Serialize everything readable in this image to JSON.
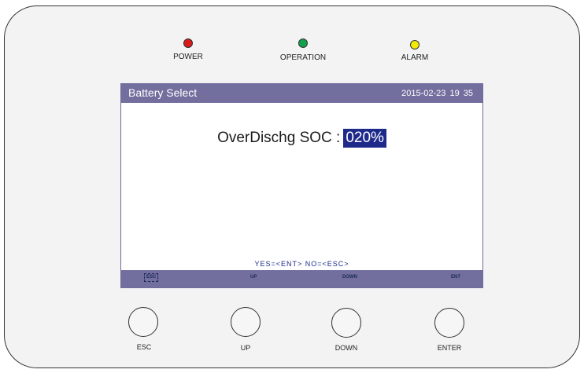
{
  "indicators": [
    {
      "label": "POWER",
      "color": "#d81a1a"
    },
    {
      "label": "OPERATION",
      "color": "#12a04a"
    },
    {
      "label": "ALARM",
      "color": "#f2ea05"
    }
  ],
  "screen": {
    "title": "Battery Select",
    "datetime": "2015-02-23  19 35",
    "setting_label": "OverDischg SOC :",
    "setting_value": "020%",
    "prompt": "YES=<ENT>  NO=<ESC>",
    "softkeys": [
      "ESC",
      "UP",
      "DOWN",
      "ENT"
    ]
  },
  "buttons": [
    {
      "label": "ESC"
    },
    {
      "label": "UP"
    },
    {
      "label": "DOWN"
    },
    {
      "label": "ENTER"
    }
  ]
}
